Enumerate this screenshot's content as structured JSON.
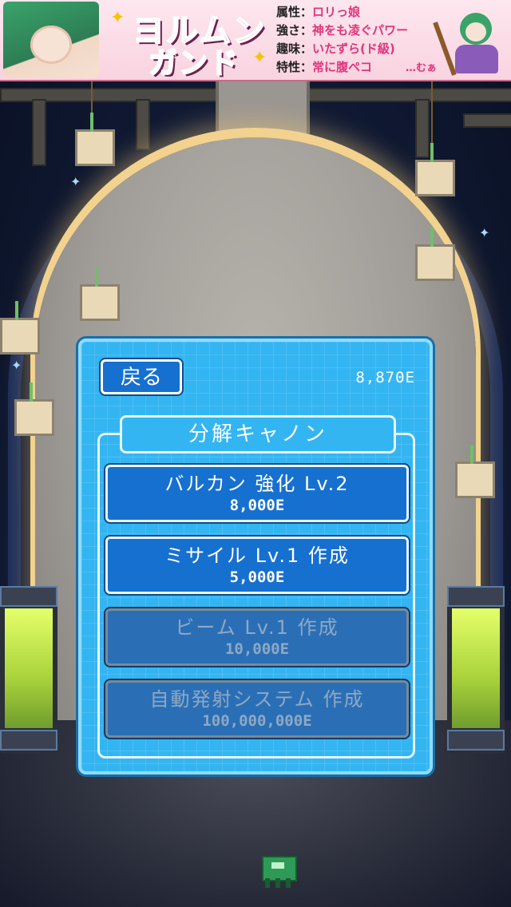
{
  "banner": {
    "logo_line1": "ヨルムン",
    "logo_line2": "ガンド",
    "attributes": [
      {
        "key": "属性：",
        "value": "ロリっ娘"
      },
      {
        "key": "強さ：",
        "value": "神をも凌ぐパワー"
      },
      {
        "key": "趣味：",
        "value": "いたずら(ド級)"
      },
      {
        "key": "特性：",
        "value": "常に腹ペコ"
      }
    ],
    "muu": "…むぁ"
  },
  "shop": {
    "back_label": "戻る",
    "money": "8,870E",
    "title": "分解キャノン",
    "items": [
      {
        "name": "バルカン 強化 Lv.2",
        "price": "8,000E",
        "state": "enabled"
      },
      {
        "name": "ミサイル Lv.1 作成",
        "price": "5,000E",
        "state": "enabled"
      },
      {
        "name": "ビーム Lv.1 作成",
        "price": "10,000E",
        "state": "disabled"
      },
      {
        "name": "自動発射システム 作成",
        "price": "100,000,000E",
        "state": "disabled"
      }
    ]
  },
  "colors": {
    "panel": "#33b5f2",
    "button_enabled": "#1670cf",
    "button_disabled": "#2a6fb6",
    "banner_accent": "#e0357c"
  }
}
